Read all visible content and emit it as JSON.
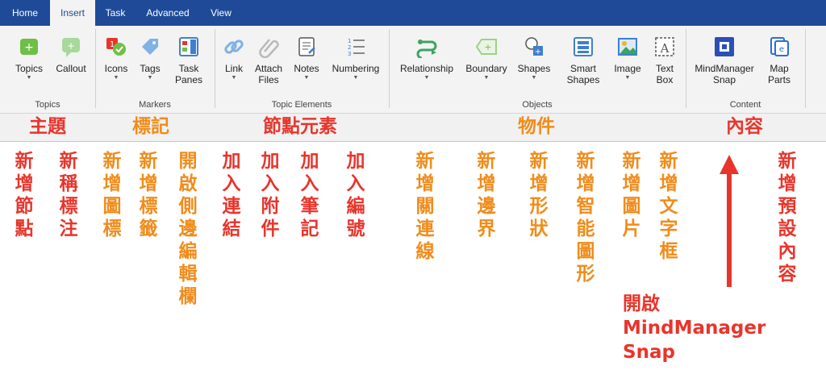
{
  "tabs": [
    {
      "label": "Home"
    },
    {
      "label": "Insert"
    },
    {
      "label": "Task"
    },
    {
      "label": "Advanced"
    },
    {
      "label": "View"
    }
  ],
  "ribbon": {
    "buttons": [
      {
        "label": "Topics",
        "icon": "topic-add-icon",
        "dropdown": true
      },
      {
        "label": "Callout",
        "icon": "callout-add-icon",
        "dropdown": false
      },
      {
        "label": "Icons",
        "icon": "icons-icon",
        "dropdown": true
      },
      {
        "label": "Tags",
        "icon": "tag-icon",
        "dropdown": true
      },
      {
        "label": "Task\nPanes",
        "icon": "task-panes-icon",
        "dropdown": false
      },
      {
        "label": "Link",
        "icon": "link-icon",
        "dropdown": true
      },
      {
        "label": "Attach\nFiles",
        "icon": "paperclip-icon",
        "dropdown": false
      },
      {
        "label": "Notes",
        "icon": "notes-icon",
        "dropdown": true
      },
      {
        "label": "Numbering",
        "icon": "numbering-icon",
        "dropdown": true
      },
      {
        "label": "Relationship",
        "icon": "relationship-icon",
        "dropdown": true
      },
      {
        "label": "Boundary",
        "icon": "boundary-icon",
        "dropdown": true
      },
      {
        "label": "Shapes",
        "icon": "shapes-icon",
        "dropdown": true
      },
      {
        "label": "Smart\nShapes",
        "icon": "smart-shapes-icon",
        "dropdown": true
      },
      {
        "label": "Image",
        "icon": "image-icon",
        "dropdown": true
      },
      {
        "label": "Text\nBox",
        "icon": "text-box-icon",
        "dropdown": false
      },
      {
        "label": "MindManager\nSnap",
        "icon": "snap-icon",
        "dropdown": false
      },
      {
        "label": "Map\nParts",
        "icon": "map-parts-icon",
        "dropdown": false
      }
    ],
    "groups": [
      {
        "label": "Topics"
      },
      {
        "label": "Markers"
      },
      {
        "label": "Topic Elements"
      },
      {
        "label": "Objects"
      },
      {
        "label": "Content"
      }
    ]
  },
  "annotations": {
    "headers": [
      {
        "text": "主題",
        "color": "red"
      },
      {
        "text": "標記",
        "color": "orange"
      },
      {
        "text": "節點元素",
        "color": "red"
      },
      {
        "text": "物件",
        "color": "orange"
      },
      {
        "text": "內容",
        "color": "red"
      }
    ],
    "vertical": [
      {
        "text": "新增節點",
        "color": "red"
      },
      {
        "text": "新稱標注",
        "color": "red"
      },
      {
        "text": "新增圖標",
        "color": "orange"
      },
      {
        "text": "新增標籤",
        "color": "orange"
      },
      {
        "text": "開啟側邊編輯欄",
        "color": "orange"
      },
      {
        "text": "加入連結",
        "color": "red"
      },
      {
        "text": "加入附件",
        "color": "red"
      },
      {
        "text": "加入筆記",
        "color": "red"
      },
      {
        "text": "加入編號",
        "color": "red"
      },
      {
        "text": "新增關連線",
        "color": "orange"
      },
      {
        "text": "新增邊界",
        "color": "orange"
      },
      {
        "text": "新增形狀",
        "color": "orange"
      },
      {
        "text": "新增智能圖形",
        "color": "orange"
      },
      {
        "text": "新增圖片",
        "color": "orange"
      },
      {
        "text": "新增文字框",
        "color": "orange"
      },
      {
        "text": "新增預設內容",
        "color": "red"
      }
    ],
    "snap_note": "開啟\nMindManager\nSnap"
  },
  "colors": {
    "tabbar": "#1e4a98",
    "annotation_red": "#e8352c",
    "annotation_orange": "#f08c1b",
    "ribbon_bg": "#f3f3f3"
  }
}
